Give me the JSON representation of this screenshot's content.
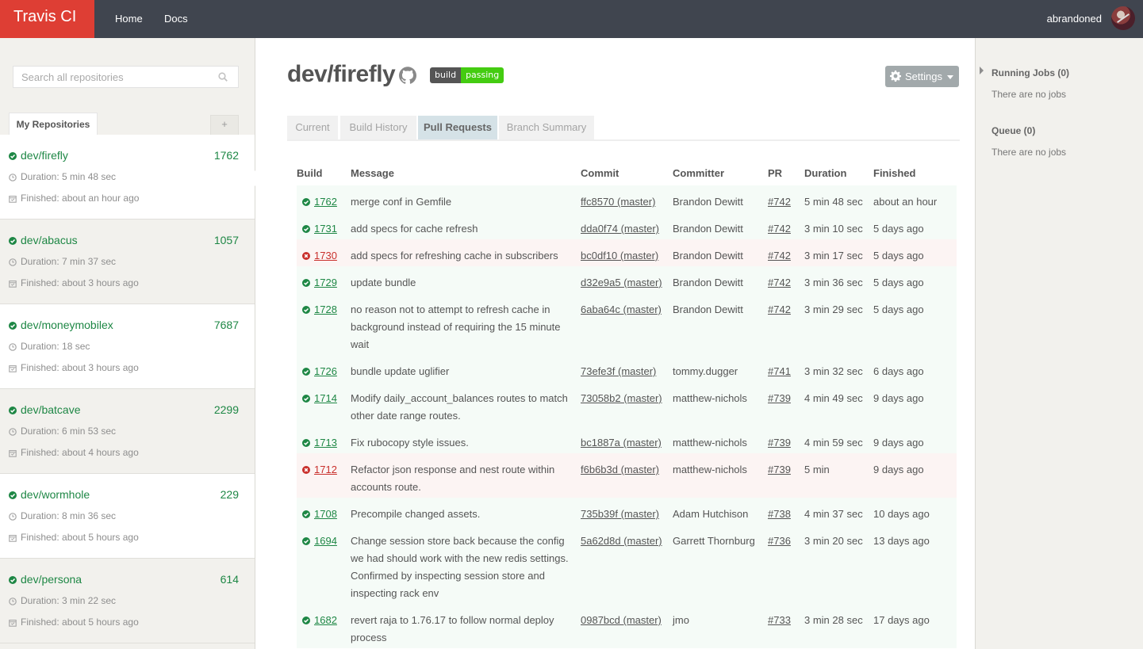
{
  "brand": "Travis CI",
  "nav": {
    "home": "Home",
    "docs": "Docs"
  },
  "user": {
    "name": "abrandoned"
  },
  "sidebar": {
    "search_placeholder": "Search all repositories",
    "tab_label": "My Repositories",
    "add_label": "+",
    "repos": [
      {
        "name": "dev/firefly",
        "count": "1762",
        "duration": "Duration: 5 min 48 sec",
        "finished": "Finished: about an hour ago"
      },
      {
        "name": "dev/abacus",
        "count": "1057",
        "duration": "Duration: 7 min 37 sec",
        "finished": "Finished: about 3 hours ago"
      },
      {
        "name": "dev/moneymobilex",
        "count": "7687",
        "duration": "Duration: 18 sec",
        "finished": "Finished: about 3 hours ago"
      },
      {
        "name": "dev/batcave",
        "count": "2299",
        "duration": "Duration: 6 min 53 sec",
        "finished": "Finished: about 4 hours ago"
      },
      {
        "name": "dev/wormhole",
        "count": "229",
        "duration": "Duration: 8 min 36 sec",
        "finished": "Finished: about 5 hours ago"
      },
      {
        "name": "dev/persona",
        "count": "614",
        "duration": "Duration: 3 min 22 sec",
        "finished": "Finished: about 5 hours ago"
      }
    ]
  },
  "main": {
    "title": "dev/firefly",
    "badge": {
      "left": "build",
      "right": "passing"
    },
    "settings_label": "Settings",
    "tabs": [
      "Current",
      "Build History",
      "Pull Requests",
      "Branch Summary"
    ],
    "table": {
      "headers": [
        "Build",
        "Message",
        "Commit",
        "Committer",
        "PR",
        "Duration",
        "Finished"
      ],
      "rows": [
        {
          "status": "passed",
          "build": "1762",
          "message": "merge conf in Gemfile",
          "commit": "ffc8570 (master)",
          "committer": "Brandon Dewitt",
          "pr": "#742",
          "duration": "5 min 48 sec",
          "finished": "about an hour ago"
        },
        {
          "status": "passed",
          "build": "1731",
          "message": "add specs for cache refresh",
          "commit": "dda0f74 (master)",
          "committer": "Brandon Dewitt",
          "pr": "#742",
          "duration": "3 min 10 sec",
          "finished": "5 days ago"
        },
        {
          "status": "failed",
          "build": "1730",
          "message": "add specs for refreshing cache in subscribers",
          "commit": "bc0df10 (master)",
          "committer": "Brandon Dewitt",
          "pr": "#742",
          "duration": "3 min 17 sec",
          "finished": "5 days ago"
        },
        {
          "status": "passed",
          "build": "1729",
          "message": "update bundle",
          "commit": "d32e9a5 (master)",
          "committer": "Brandon Dewitt",
          "pr": "#742",
          "duration": "3 min 36 sec",
          "finished": "5 days ago"
        },
        {
          "status": "passed",
          "build": "1728",
          "message": "no reason not to attempt to refresh cache in background instead of requiring the 15 minute wait",
          "commit": "6aba64c (master)",
          "committer": "Brandon Dewitt",
          "pr": "#742",
          "duration": "3 min 29 sec",
          "finished": "5 days ago"
        },
        {
          "status": "passed",
          "build": "1726",
          "message": "bundle update uglifier",
          "commit": "73efe3f (master)",
          "committer": "tommy.dugger",
          "pr": "#741",
          "duration": "3 min 32 sec",
          "finished": "6 days ago"
        },
        {
          "status": "passed",
          "build": "1714",
          "message": "Modify daily_account_balances routes to match other date range routes.",
          "commit": "73058b2 (master)",
          "committer": "matthew-nichols",
          "pr": "#739",
          "duration": "4 min 49 sec",
          "finished": "9 days ago"
        },
        {
          "status": "passed",
          "build": "1713",
          "message": "Fix rubocopy style issues.",
          "commit": "bc1887a (master)",
          "committer": "matthew-nichols",
          "pr": "#739",
          "duration": "4 min 59 sec",
          "finished": "9 days ago"
        },
        {
          "status": "failed",
          "build": "1712",
          "message": "Refactor json response and nest route within accounts route.",
          "commit": "f6b6b3d (master)",
          "committer": "matthew-nichols",
          "pr": "#739",
          "duration": "5 min",
          "finished": "9 days ago"
        },
        {
          "status": "passed",
          "build": "1708",
          "message": "Precompile changed assets.",
          "commit": "735b39f (master)",
          "committer": "Adam Hutchison",
          "pr": "#738",
          "duration": "4 min 37 sec",
          "finished": "10 days ago"
        },
        {
          "status": "passed",
          "build": "1694",
          "message": "Change session store back because the config we had should work with the new redis settings. Confirmed by inspecting session store and inspecting rack env",
          "commit": "5a62d8d (master)",
          "committer": "Garrett Thornburg",
          "pr": "#736",
          "duration": "3 min 20 sec",
          "finished": "13 days ago"
        },
        {
          "status": "passed",
          "build": "1682",
          "message": "revert raja to 1.76.17 to follow normal deploy process",
          "commit": "0987bcd (master)",
          "committer": "jmo",
          "pr": "#733",
          "duration": "3 min 28 sec",
          "finished": "17 days ago"
        }
      ]
    }
  },
  "right": {
    "running_title": "Running Jobs (0)",
    "running_text": "There are no jobs",
    "queue_title": "Queue (0)",
    "queue_text": "There are no jobs"
  },
  "colors": {
    "brand": "#de3e34",
    "topbar": "#40454f",
    "passed": "#1e8745",
    "failed": "#c9302c"
  }
}
